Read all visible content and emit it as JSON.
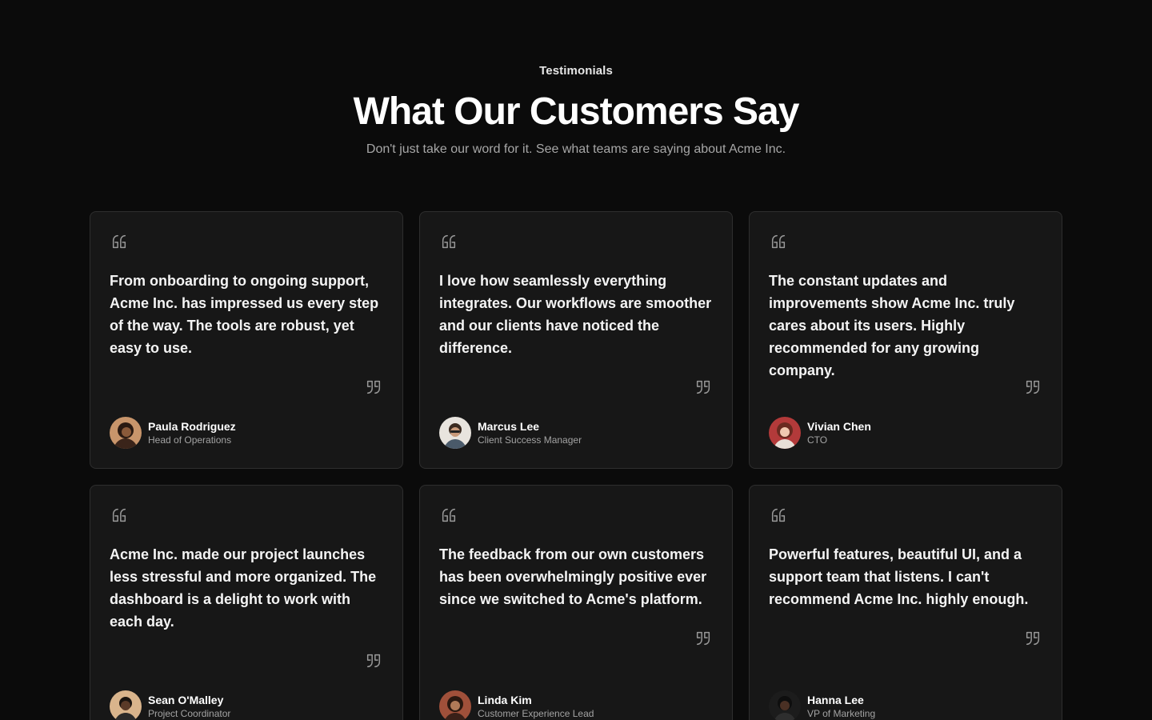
{
  "header": {
    "eyebrow": "Testimonials",
    "title": "What Our Customers Say",
    "subtitle": "Don't just take our word for it. See what teams are saying about Acme Inc."
  },
  "testimonials": [
    {
      "quote": "From onboarding to ongoing support, Acme Inc. has impressed us every step of the way. The tools are robust, yet easy to use.",
      "name": "Paula Rodriguez",
      "role": "Head of Operations",
      "avatar_icon": "avatar-photo-icon"
    },
    {
      "quote": "I love how seamlessly everything integrates. Our workflows are smoother and our clients have noticed the difference.",
      "name": "Marcus Lee",
      "role": "Client Success Manager",
      "avatar_icon": "avatar-photo-icon"
    },
    {
      "quote": "The constant updates and improvements show Acme Inc. truly cares about its users. Highly recommended for any growing company.",
      "name": "Vivian Chen",
      "role": "CTO",
      "avatar_icon": "avatar-photo-icon"
    },
    {
      "quote": "Acme Inc. made our project launches less stressful and more organized. The dashboard is a delight to work with each day.",
      "name": "Sean O'Malley",
      "role": "Project Coordinator",
      "avatar_icon": "avatar-photo-icon"
    },
    {
      "quote": "The feedback from our own customers has been overwhelmingly positive ever since we switched to Acme's platform.",
      "name": "Linda Kim",
      "role": "Customer Experience Lead",
      "avatar_icon": "avatar-photo-icon"
    },
    {
      "quote": "Powerful features, beautiful UI, and a support team that listens. I can't recommend Acme Inc. highly enough.",
      "name": "Hanna Lee",
      "role": "VP of Marketing",
      "avatar_icon": "avatar-photo-icon"
    }
  ],
  "icons": {
    "open_quote": "quote-open-icon",
    "close_quote": "quote-close-icon"
  },
  "colors": {
    "background": "#0b0b0b",
    "card": "#171717",
    "card_border": "#2e2e2e",
    "muted_text": "#a7a7a7"
  }
}
